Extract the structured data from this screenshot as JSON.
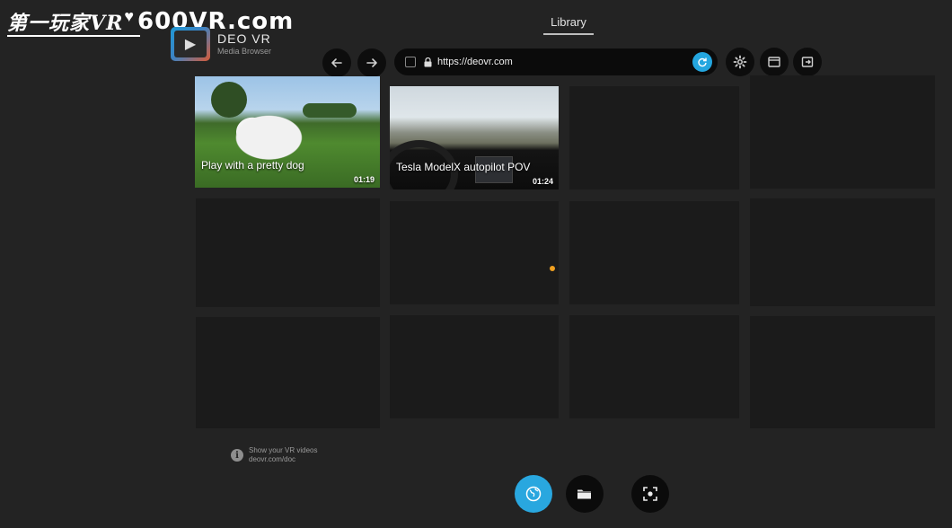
{
  "watermark": {
    "cn_text": "第一玩家VR",
    "site": "600VR.com"
  },
  "logo": {
    "title": "DEO VR",
    "subtitle": "Media Browser"
  },
  "tabs": [
    {
      "label": "Library",
      "active": true
    }
  ],
  "nav": {
    "back_icon": "arrow-left-icon",
    "forward_icon": "arrow-right-icon",
    "url": "https://deovr.com",
    "refresh_icon": "refresh-icon",
    "settings_icon": "gear-icon",
    "window_icon": "window-icon",
    "exit_icon": "exit-icon"
  },
  "videos": [
    {
      "title": "Play with a pretty dog",
      "duration": "01:19"
    },
    {
      "title": "Tesla ModelX autopilot POV",
      "duration": "01:24"
    }
  ],
  "info": {
    "line1": "Show your VR videos",
    "line2": "deovr.com/doc"
  },
  "bottom_bar": {
    "active": "globe",
    "accent_color": "#29a7df"
  }
}
